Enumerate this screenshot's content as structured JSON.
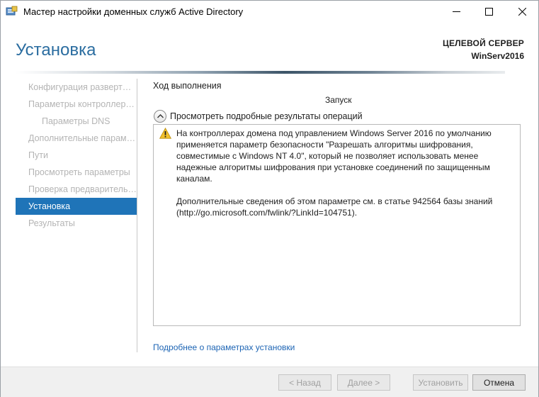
{
  "window": {
    "title": "Мастер настройки доменных служб Active Directory"
  },
  "header": {
    "page_title": "Установка",
    "target_label": "ЦЕЛЕВОЙ СЕРВЕР",
    "target_name": "WinServ2016"
  },
  "sidebar": {
    "items": [
      {
        "label": "Конфигурация развертывания"
      },
      {
        "label": "Параметры контроллера домена"
      },
      {
        "label": "Параметры DNS"
      },
      {
        "label": "Дополнительные параметры"
      },
      {
        "label": "Пути"
      },
      {
        "label": "Просмотреть параметры"
      },
      {
        "label": "Проверка предварительных требований"
      },
      {
        "label": "Установка"
      },
      {
        "label": "Результаты"
      }
    ],
    "active_index": 7
  },
  "content": {
    "section_label": "Ход выполнения",
    "status": "Запуск",
    "details_toggle": "Просмотреть подробные результаты операций",
    "message_p1": "На контроллерах домена под управлением Windows Server 2016 по умолчанию применяется параметр безопасности \"Разрешать алгоритмы шифрования, совместимые с Windows NT 4.0\", который не позволяет использовать менее надежные алгоритмы шифрования при установке соединений по защищенным каналам.",
    "message_p2": "Дополнительные сведения об этом параметре см. в статье 942564 базы знаний (http://go.microsoft.com/fwlink/?LinkId=104751).",
    "more_link": "Подробнее о параметрах установки"
  },
  "footer": {
    "back_label": "< Назад",
    "next_label": "Далее >",
    "install_label": "Установить",
    "cancel_label": "Отмена"
  },
  "colors": {
    "accent": "#1f74b8",
    "title": "#2b6da0",
    "link": "#1c64b4",
    "warning": "#f2c12e"
  },
  "icons": {
    "app": "server-wizard-icon",
    "warning": "warning-icon",
    "collapse": "chevron-up-icon"
  }
}
